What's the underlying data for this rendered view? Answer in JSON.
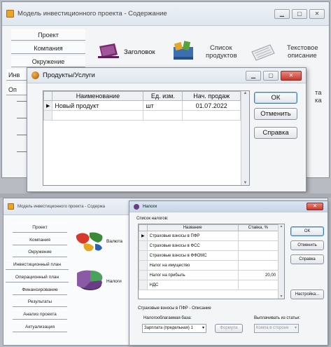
{
  "top": {
    "window_title": "Модель инвестиционного проекта - Содержание",
    "nav": [
      "Проект",
      "Компания",
      "Окружение",
      "Инв",
      "Оп"
    ],
    "icons": {
      "title_label": "Заголовок",
      "products_label_1": "Список",
      "products_label_2": "продуктов",
      "text_label_1": "Текстовое",
      "text_label_2": "описание",
      "partial_1": "та",
      "partial_2": "ка"
    },
    "dialog": {
      "title": "Продукты/Услуги",
      "columns": [
        "Наименование",
        "Ед. изм.",
        "Нач. продаж"
      ],
      "rows": [
        {
          "name": "Новый продукт",
          "unit": "шт",
          "start": "01.07.2022"
        }
      ],
      "ok": "ОК",
      "cancel": "Отменить",
      "help": "Справка"
    }
  },
  "bottom": {
    "window_title": "Модель инвестиционного проекта - Содержа",
    "nav": [
      "Проект",
      "Компания",
      "Окружение",
      "Инвестиционный план",
      "Операционный план",
      "Финансирование",
      "Результаты",
      "Анализ проекта",
      "Актуализация"
    ],
    "icons": {
      "currency": "Валюта",
      "taxes": "Налоги"
    },
    "dialog": {
      "title": "Налоги",
      "list_label": "Список налогов:",
      "columns": [
        "Название",
        "Ставка, %"
      ],
      "rows": [
        {
          "name": "Страховые взносы в ПФР",
          "rate": ""
        },
        {
          "name": "Страховые взносы в ФСС",
          "rate": ""
        },
        {
          "name": "Страховые взносы в ФФОМС",
          "rate": ""
        },
        {
          "name": "Налог на имущество",
          "rate": ""
        },
        {
          "name": "Налог на прибыль",
          "rate": "20,00"
        },
        {
          "name": "НДС",
          "rate": ""
        }
      ],
      "ok": "ОК",
      "cancel": "Отменить",
      "help": "Справка",
      "settings": "Настройка...",
      "desc_label": "Страховые взносы в ПФР - Описание",
      "base_label": "Налогооблагаемая база:",
      "base_value": "Зарплата (предельная) 1",
      "formula": "Формула",
      "pay_label": "Выплачивать из статьи:",
      "pay_value": "Компа в стороне"
    }
  },
  "colors": {
    "accent": "#c8392c",
    "link_blue": "#3c7fb1"
  }
}
